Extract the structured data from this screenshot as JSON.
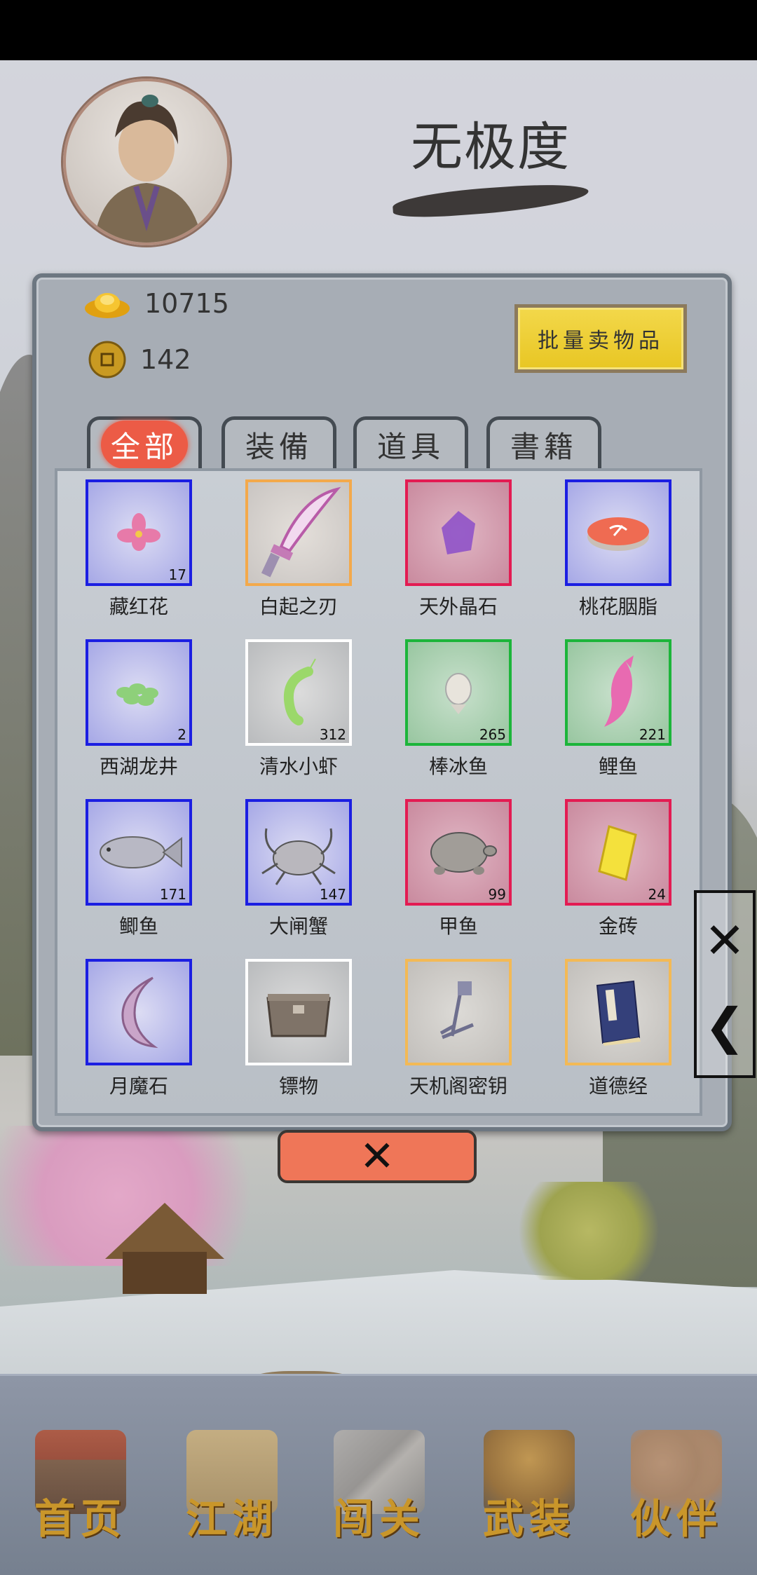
{
  "player": {
    "name": "无极度"
  },
  "currency": {
    "ingots": "10715",
    "coins": "142"
  },
  "sell_button_label": "批量卖物品",
  "tabs": [
    {
      "label": "全部",
      "active": true
    },
    {
      "label": "装備",
      "active": false
    },
    {
      "label": "道具",
      "active": false
    },
    {
      "label": "書籍",
      "active": false
    }
  ],
  "items": [
    {
      "name": "藏红花",
      "count": "17",
      "quality": "blue",
      "icon": "flower-icon"
    },
    {
      "name": "白起之刃",
      "count": "",
      "quality": "orange",
      "icon": "blade-icon"
    },
    {
      "name": "天外晶石",
      "count": "",
      "quality": "red",
      "icon": "crystal-icon"
    },
    {
      "name": "桃花胭脂",
      "count": "",
      "quality": "blue",
      "icon": "rouge-icon"
    },
    {
      "name": "西湖龙井",
      "count": "2",
      "quality": "blue",
      "icon": "tea-icon"
    },
    {
      "name": "清水小虾",
      "count": "312",
      "quality": "white",
      "icon": "shrimp-icon"
    },
    {
      "name": "棒冰鱼",
      "count": "265",
      "quality": "green",
      "icon": "fish-icon"
    },
    {
      "name": "鲤鱼",
      "count": "221",
      "quality": "green",
      "icon": "carp-icon"
    },
    {
      "name": "鲫鱼",
      "count": "171",
      "quality": "blue",
      "icon": "crucian-icon"
    },
    {
      "name": "大闸蟹",
      "count": "147",
      "quality": "blue",
      "icon": "crab-icon"
    },
    {
      "name": "甲鱼",
      "count": "99",
      "quality": "red",
      "icon": "turtle-icon"
    },
    {
      "name": "金砖",
      "count": "24",
      "quality": "red",
      "icon": "gold-brick-icon"
    },
    {
      "name": "月魔石",
      "count": "",
      "quality": "blue",
      "icon": "moon-stone-icon"
    },
    {
      "name": "镖物",
      "count": "",
      "quality": "white",
      "icon": "cargo-box-icon"
    },
    {
      "name": "天机阁密钥",
      "count": "",
      "quality": "gold",
      "icon": "key-icon"
    },
    {
      "name": "道德经",
      "count": "",
      "quality": "gold",
      "icon": "book-icon"
    }
  ],
  "close_button_glyph": "✕",
  "side_controls": {
    "close_glyph": "✕",
    "back_glyph": "❮"
  },
  "nav": [
    {
      "label": "首页",
      "icon": "house-icon"
    },
    {
      "label": "江湖",
      "icon": "scroll-icon"
    },
    {
      "label": "闯关",
      "icon": "swords-icon"
    },
    {
      "label": "武装",
      "icon": "armor-icon"
    },
    {
      "label": "伙伴",
      "icon": "partners-icon"
    }
  ],
  "colors": {
    "accent_red": "#ec5b46",
    "sell_yellow": "#f3d84b",
    "nav_gold": "#c9962a",
    "quality_blue": "#1b1ee2",
    "quality_orange": "#f3a94b",
    "quality_red": "#e31b52",
    "quality_white": "#ffffff",
    "quality_green": "#1cb53a"
  }
}
